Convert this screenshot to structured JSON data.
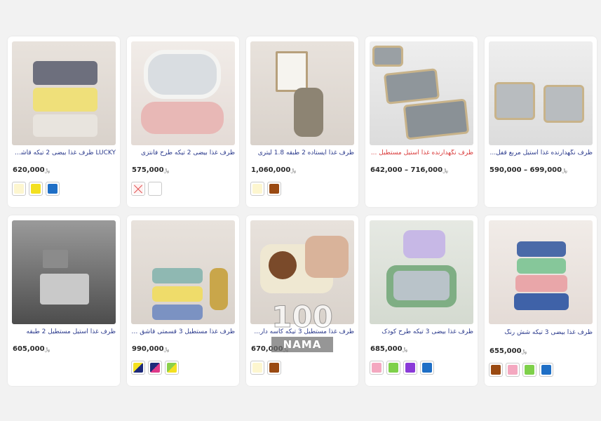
{
  "currency": "﷼",
  "products": [
    {
      "title": "LUCKY ظرف غذا بیضی 2 تیکه قاشق دار",
      "price": "620,000",
      "swatches": [
        "#fdf6cf",
        "#f3e020",
        "#1f6fc6"
      ]
    },
    {
      "title": "ظرف غذا بیضی 2 تیکه طرح فانتزی",
      "price": "575,000",
      "swatches": [
        "x",
        "#ffffff"
      ]
    },
    {
      "title": "ظرف غذا ایستاده 2 طبقه 1.8 لیتری",
      "price": "1,060,000",
      "swatches": [
        "#fdf6cf",
        "#9a4a12"
      ]
    },
    {
      "title": "ظرف نگهدارنده غذا استیل مستطیل ...",
      "price": "716,000 – 642,000",
      "swatches": [],
      "title_color": "#d93a3a"
    },
    {
      "title": "ظرف نگهدارنده غذا استیل مربع قفل...",
      "price": "699,000 – 590,000",
      "swatches": []
    },
    {
      "title": "ظرف غذا استیل مستطیل 2 طبقه",
      "price": "605,000",
      "swatches": []
    },
    {
      "title": "ظرف غذا مستطیل 3 قسمتی قاشق و...",
      "price": "990,000",
      "swatches": [
        "diag:#f3e020:#1d2a7a",
        "diag:#1d2a7a:#e03a8a",
        "diag:#8bd04a:#f3e020"
      ]
    },
    {
      "title": "ظرف غذا مستطیل 3 تیکه کاسه دار...",
      "price": "670,000",
      "swatches": [
        "#fdf6cf",
        "#9a4a12"
      ]
    },
    {
      "title": "ظرف غذا بیضی 3 تیکه طرح کودک",
      "price": "685,000",
      "swatches": [
        "#f4a8c0",
        "#7ed04a",
        "#8a3ad8",
        "#1f6fc6"
      ]
    },
    {
      "title": "ظرف غذا بیضی 3 تیکه شش رنگ",
      "price": "655,000",
      "swatches": [
        "#9a4a12",
        "#f4a8c0",
        "#7ed04a",
        "#1f6fc6"
      ]
    }
  ],
  "watermark": {
    "number": "100",
    "brand": "NAMA"
  }
}
